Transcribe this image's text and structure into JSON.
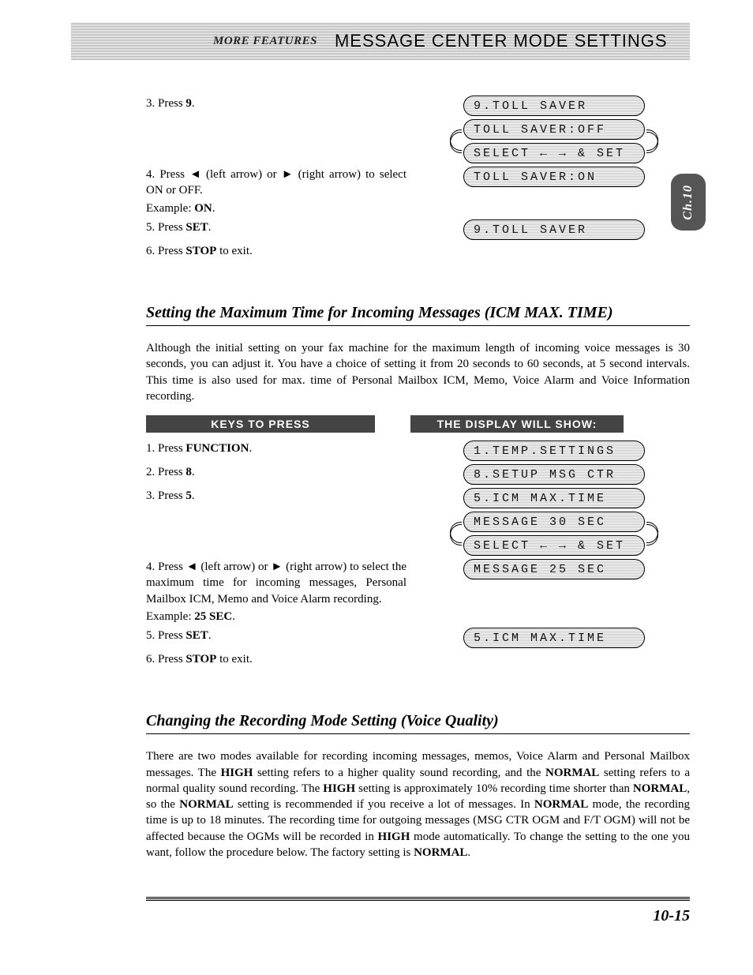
{
  "header": {
    "left": "MORE FEATURES",
    "right": "MESSAGE CENTER MODE SETTINGS"
  },
  "side_tab": "Ch.10",
  "toll_saver_tail": {
    "steps": [
      {
        "n": "3.",
        "text_pre": "Press ",
        "bold": "9",
        "text_post": ".",
        "lcds": [
          "9.TOLL SAVER",
          "TOLL SAVER:OFF",
          "SELECT ← → & SET"
        ]
      },
      {
        "n": "4.",
        "text": "Press ◄ (left arrow) or ► (right arrow) to select ON or OFF.",
        "sub_pre": "Example: ",
        "sub_bold": "ON",
        "sub_post": ".",
        "lcds": [
          "TOLL SAVER:ON"
        ]
      },
      {
        "n": "5.",
        "text_pre": "Press ",
        "bold": "SET",
        "text_post": ".",
        "lcds": [
          "9.TOLL SAVER"
        ]
      },
      {
        "n": "6.",
        "text_pre": "Press ",
        "bold": "STOP",
        "text_post": " to exit.",
        "lcds": []
      }
    ]
  },
  "icm": {
    "heading": "Setting the Maximum Time for Incoming Messages (ICM MAX. TIME)",
    "intro": "Although the initial setting on your fax machine for the maximum length of incoming voice messages is 30 seconds, you can adjust it. You have a choice of setting it from 20 seconds to 60 seconds, at 5 second intervals. This time is also used for max. time of Personal Mailbox ICM, Memo, Voice Alarm and Voice Information recording.",
    "col_left": "KEYS TO PRESS",
    "col_right": "THE DISPLAY WILL SHOW:",
    "steps": [
      {
        "n": "1.",
        "text_pre": "Press ",
        "bold": "FUNCTION",
        "text_post": ".",
        "lcds": [
          "1.TEMP.SETTINGS"
        ]
      },
      {
        "n": "2.",
        "text_pre": "Press ",
        "bold": "8",
        "text_post": ".",
        "lcds": [
          "8.SETUP MSG CTR"
        ]
      },
      {
        "n": "3.",
        "text_pre": "Press ",
        "bold": "5",
        "text_post": ".",
        "lcds": [
          "5.ICM MAX.TIME",
          "MESSAGE 30 SEC",
          "SELECT ← → & SET"
        ]
      },
      {
        "n": "4.",
        "text": "Press ◄ (left arrow) or ► (right arrow) to select the maximum time for incoming messages, Personal Mailbox ICM, Memo and Voice Alarm recording.",
        "sub_pre": "Example: ",
        "sub_bold": "25 SEC",
        "sub_post": ".",
        "lcds": [
          "MESSAGE 25 SEC"
        ]
      },
      {
        "n": "5.",
        "text_pre": "Press ",
        "bold": "SET",
        "text_post": ".",
        "lcds": [
          "5.ICM MAX.TIME"
        ]
      },
      {
        "n": "6.",
        "text_pre": "Press ",
        "bold": "STOP",
        "text_post": " to exit.",
        "lcds": []
      }
    ]
  },
  "voice": {
    "heading": "Changing the Recording Mode Setting (Voice Quality)",
    "body_html": "There are two modes available for recording incoming messages, memos, Voice Alarm and Personal Mailbox messages. The <b>HIGH</b> setting refers to a higher quality sound recording, and the <b>NORMAL</b> setting refers to a normal quality sound recording. The <b>HIGH</b> setting is approximately 10% recording time shorter than <b>NORMAL</b>, so the <b>NORMAL</b> setting is recommended if you receive a lot of messages. In <b>NORMAL</b> mode, the recording time is up to 18 minutes. The recording time for outgoing messages (MSG CTR OGM and F/T OGM) will not be affected because the OGMs will be recorded in <b>HIGH</b> mode automatically. To change the setting to the one you want, follow the procedure below. The factory setting is <b>NORMAL</b>."
  },
  "page_number": "10-15"
}
